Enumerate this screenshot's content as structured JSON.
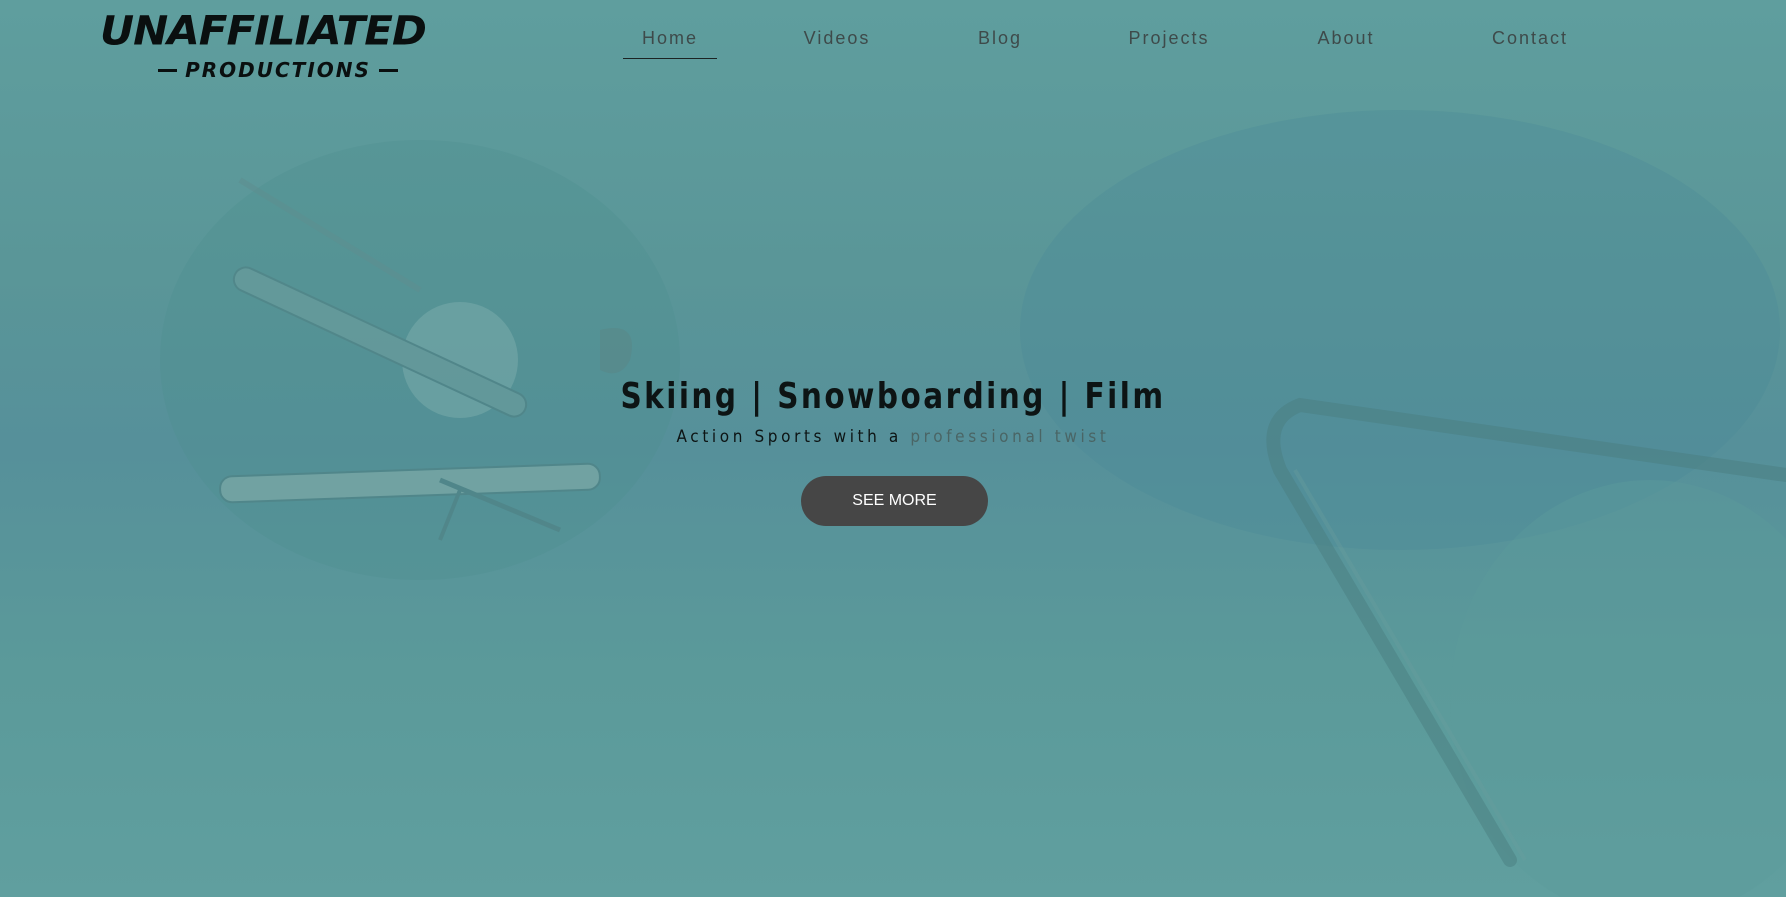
{
  "brand": {
    "name": "UNAFFILIATED",
    "tagline": "PRODUCTIONS"
  },
  "nav": {
    "items": [
      {
        "label": "Home",
        "active": true
      },
      {
        "label": "Videos",
        "active": false
      },
      {
        "label": "Blog",
        "active": false
      },
      {
        "label": "Projects",
        "active": false
      },
      {
        "label": "About",
        "active": false
      },
      {
        "label": "Contact",
        "active": false
      }
    ]
  },
  "hero": {
    "title": "Skiing | Snowboarding | Film",
    "subtitle_lead": "Action Sports with a ",
    "subtitle_accent": "professional twist",
    "cta_label": "SEE MORE"
  },
  "colors": {
    "background": "#5f9d9d",
    "text_dark": "#0d1414",
    "nav_text": "#3e4a4a",
    "accent_text": "#4a6565",
    "cta_bg": "#464646",
    "cta_text": "#ffffff"
  }
}
